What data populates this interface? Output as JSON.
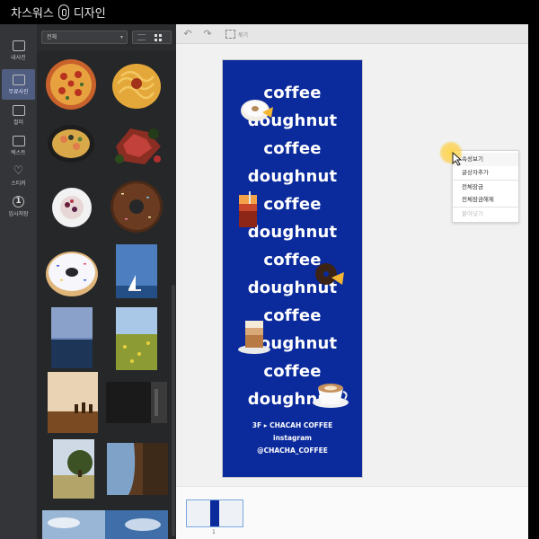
{
  "titlebar": {
    "brand_left": "차스워스",
    "brand_right": "디자인"
  },
  "rail": {
    "items": [
      {
        "label": "내사진",
        "icon": "photo-icon",
        "active": false
      },
      {
        "label": "무료사진",
        "icon": "free-photo-icon",
        "active": true
      },
      {
        "label": "컬러",
        "icon": "color-icon",
        "active": false
      },
      {
        "label": "텍스트",
        "icon": "text-icon",
        "active": false
      },
      {
        "label": "스티커",
        "icon": "heart-icon",
        "active": false
      },
      {
        "label": "임시저장",
        "icon": "save-one-icon",
        "active": false
      }
    ]
  },
  "panel": {
    "category_select": "전체",
    "scrollbar_color": "#3b3b3d"
  },
  "toolbar": {
    "undo_icon": "undo-icon",
    "redo_icon": "redo-icon",
    "group_label": "묶기"
  },
  "canvas": {
    "background": "#0b2a9c",
    "lines": [
      "coffee",
      "doughnut",
      "coffee",
      "doughnut",
      "coffee",
      "doughnut",
      "coffee",
      "doughnut",
      "coffee",
      "doughnut",
      "coffee",
      "doughnut"
    ],
    "footer": {
      "line1": "3F ▸ CHACAH COFFEE",
      "line2": "instagram",
      "line3": "@CHACHA_COFFEE"
    }
  },
  "context_menu": {
    "items": [
      {
        "label": "속성보기",
        "disabled": false
      },
      {
        "label": "글상자추가",
        "disabled": false
      },
      {
        "label": "전체잠금",
        "disabled": false
      },
      {
        "label": "전체잠금해제",
        "disabled": false
      },
      {
        "label": "붙여넣기",
        "disabled": true
      }
    ]
  },
  "pages": {
    "current": "1"
  }
}
